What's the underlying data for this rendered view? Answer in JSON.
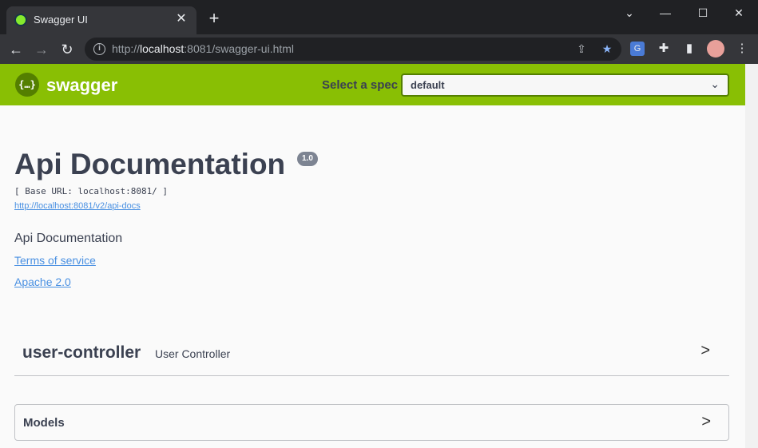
{
  "browser": {
    "tab_title": "Swagger UI",
    "tab_close": "✕",
    "new_tab": "+",
    "url_prefix": "http://",
    "url_host": "localhost",
    "url_rest": ":8081/swagger-ui.html"
  },
  "topbar": {
    "logo_glyph": "{…}",
    "brand": "swagger",
    "spec_label": "Select a spec",
    "spec_value": "default"
  },
  "info": {
    "title": "Api Documentation",
    "version": "1.0",
    "base_url": "[ Base URL: localhost:8081/ ]",
    "api_docs_url": "http://localhost:8081/v2/api-docs",
    "description": "Api Documentation",
    "terms": "Terms of service",
    "license": "Apache 2.0"
  },
  "tags": [
    {
      "name": "user-controller",
      "description": "User Controller"
    }
  ],
  "models": {
    "label": "Models"
  },
  "colors": {
    "topbar": "#89bf04",
    "text": "#3b4151",
    "link": "#4990e2"
  }
}
